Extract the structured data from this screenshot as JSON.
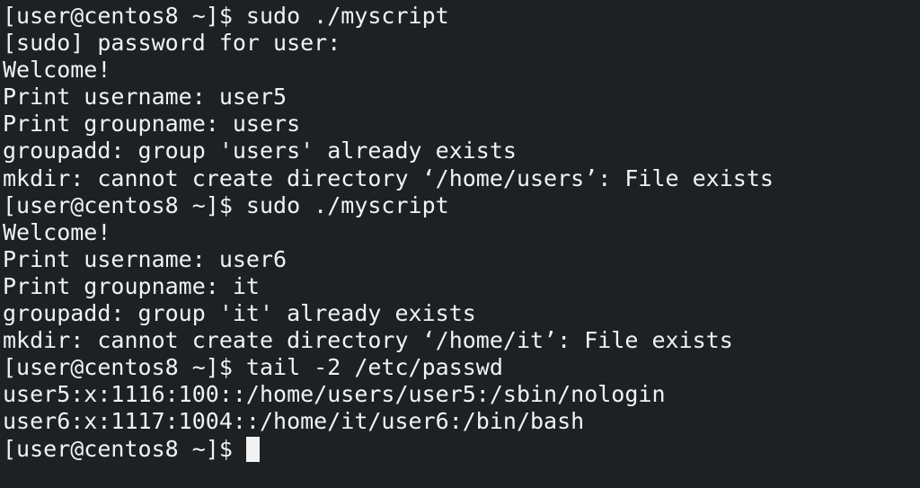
{
  "terminal": {
    "lines": [
      "[user@centos8 ~]$ sudo ./myscript",
      "[sudo] password for user:",
      "Welcome!",
      "Print username: user5",
      "Print groupname: users",
      "groupadd: group 'users' already exists",
      "mkdir: cannot create directory ‘/home/users’: File exists",
      "[user@centos8 ~]$ sudo ./myscript",
      "Welcome!",
      "Print username: user6",
      "Print groupname: it",
      "groupadd: group 'it' already exists",
      "mkdir: cannot create directory ‘/home/it’: File exists",
      "[user@centos8 ~]$ tail -2 /etc/passwd",
      "user5:x:1116:100::/home/users/user5:/sbin/nologin",
      "user6:x:1117:1004::/home/it/user6:/bin/bash"
    ],
    "prompt": "[user@centos8 ~]$ "
  },
  "colors": {
    "background": "#1e2124",
    "foreground": "#f2f2f2",
    "cursor": "#f2f2f2"
  }
}
